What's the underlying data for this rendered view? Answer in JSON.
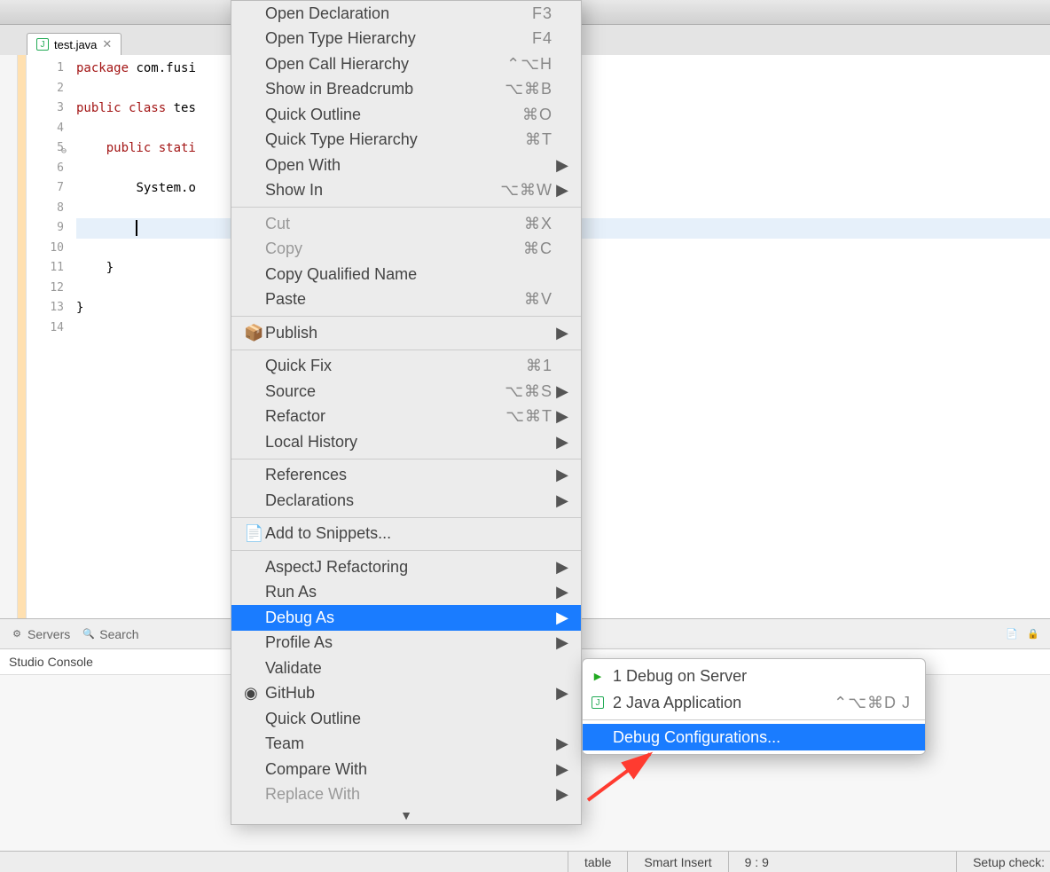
{
  "tab": {
    "filename": "test.java"
  },
  "code": {
    "lines": [
      {
        "n": "1",
        "pre": "",
        "kw": "package",
        "rest": " com.fusi"
      },
      {
        "n": "2",
        "pre": "",
        "kw": "",
        "rest": ""
      },
      {
        "n": "3",
        "pre": "",
        "kw": "public class",
        "rest": " tes"
      },
      {
        "n": "4",
        "pre": "",
        "kw": "",
        "rest": ""
      },
      {
        "n": "5",
        "pre": "    ",
        "kw": "public stati",
        "rest": ""
      },
      {
        "n": "6",
        "pre": "",
        "kw": "",
        "rest": ""
      },
      {
        "n": "7",
        "pre": "        ",
        "kw": "",
        "rest": "System.o"
      },
      {
        "n": "8",
        "pre": "",
        "kw": "",
        "rest": ""
      },
      {
        "n": "9",
        "pre": "        ",
        "kw": "",
        "rest": "",
        "caret": true,
        "hl": true
      },
      {
        "n": "10",
        "pre": "",
        "kw": "",
        "rest": ""
      },
      {
        "n": "11",
        "pre": "    ",
        "kw": "",
        "rest": "}"
      },
      {
        "n": "12",
        "pre": "",
        "kw": "",
        "rest": ""
      },
      {
        "n": "13",
        "pre": "",
        "kw": "",
        "rest": "}"
      },
      {
        "n": "14",
        "pre": "",
        "kw": "",
        "rest": ""
      }
    ]
  },
  "menu": {
    "items": [
      {
        "label": "Open Declaration",
        "shortcut": "F3"
      },
      {
        "label": "Open Type Hierarchy",
        "shortcut": "F4"
      },
      {
        "label": "Open Call Hierarchy",
        "shortcut": "⌃⌥H"
      },
      {
        "label": "Show in Breadcrumb",
        "shortcut": "⌥⌘B"
      },
      {
        "label": "Quick Outline",
        "shortcut": "⌘O"
      },
      {
        "label": "Quick Type Hierarchy",
        "shortcut": "⌘T"
      },
      {
        "label": "Open With",
        "submenu": true
      },
      {
        "label": "Show In",
        "shortcut": "⌥⌘W",
        "submenu": true
      },
      {
        "sep": true
      },
      {
        "label": "Cut",
        "shortcut": "⌘X",
        "disabled": true
      },
      {
        "label": "Copy",
        "shortcut": "⌘C",
        "disabled": true
      },
      {
        "label": "Copy Qualified Name"
      },
      {
        "label": "Paste",
        "shortcut": "⌘V"
      },
      {
        "sep": true
      },
      {
        "label": "Publish",
        "icon": "📦",
        "submenu": true
      },
      {
        "sep": true
      },
      {
        "label": "Quick Fix",
        "shortcut": "⌘1"
      },
      {
        "label": "Source",
        "shortcut": "⌥⌘S",
        "submenu": true
      },
      {
        "label": "Refactor",
        "shortcut": "⌥⌘T",
        "submenu": true
      },
      {
        "label": "Local History",
        "submenu": true
      },
      {
        "sep": true
      },
      {
        "label": "References",
        "submenu": true
      },
      {
        "label": "Declarations",
        "submenu": true
      },
      {
        "sep": true
      },
      {
        "label": "Add to Snippets...",
        "icon": "📄"
      },
      {
        "sep": true
      },
      {
        "label": "AspectJ Refactoring",
        "submenu": true
      },
      {
        "label": "Run As",
        "submenu": true
      },
      {
        "label": "Debug As",
        "submenu": true,
        "selected": true
      },
      {
        "label": "Profile As",
        "submenu": true
      },
      {
        "label": "Validate"
      },
      {
        "label": "GitHub",
        "icon": "◉",
        "submenu": true
      },
      {
        "label": "Quick Outline"
      },
      {
        "label": "Team",
        "submenu": true
      },
      {
        "label": "Compare With",
        "submenu": true
      },
      {
        "label": "Replace With",
        "submenu": true,
        "disabled": true
      }
    ]
  },
  "submenu": {
    "items": [
      {
        "num": "1",
        "label": "Debug on Server",
        "icon": "▶"
      },
      {
        "num": "2",
        "label": "Java Application",
        "icon": "J",
        "shortcut": "⌃⌥⌘D J"
      },
      {
        "sep": true
      },
      {
        "label": "Debug Configurations...",
        "selected": true
      }
    ]
  },
  "views": {
    "tabs": [
      "Servers",
      "Search"
    ],
    "console_title": "Studio Console"
  },
  "status": {
    "writable": "table",
    "insert": "Smart Insert",
    "pos": "9 : 9",
    "setup": "Setup check:"
  }
}
